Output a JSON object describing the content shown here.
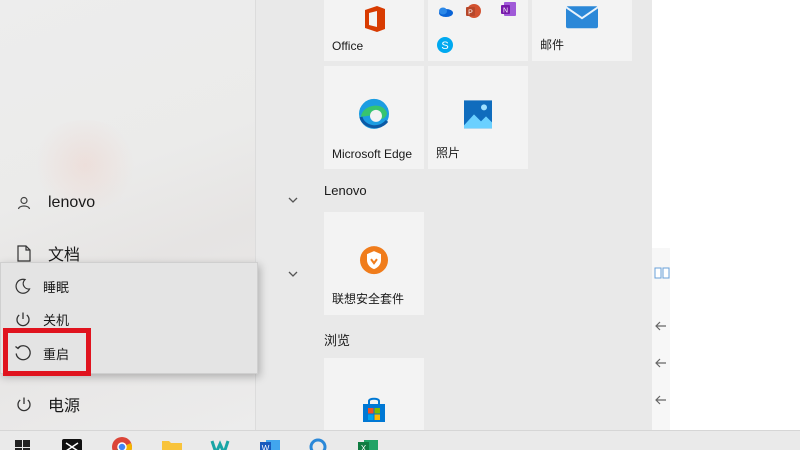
{
  "start_menu": {
    "user": {
      "name": "lenovo"
    },
    "documents": {
      "label": "文档"
    },
    "power": {
      "label": "电源"
    },
    "power_menu": {
      "sleep": "睡眠",
      "shutdown": "关机",
      "restart": "重启"
    }
  },
  "tiles": {
    "office": "Office",
    "mail": "邮件",
    "edge": "Microsoft Edge",
    "photos": "照片",
    "lenovo_security": "联想安全套件"
  },
  "sections": {
    "lenovo": "Lenovo",
    "browse": "浏览"
  },
  "colors": {
    "highlight_box": "#e0131e",
    "tiles_background": "#e9e9e9"
  },
  "taskbar": {
    "apps": [
      "windows-start",
      "msn-feed",
      "chrome",
      "file-explorer",
      "wps",
      "word",
      "search",
      "excel"
    ]
  }
}
